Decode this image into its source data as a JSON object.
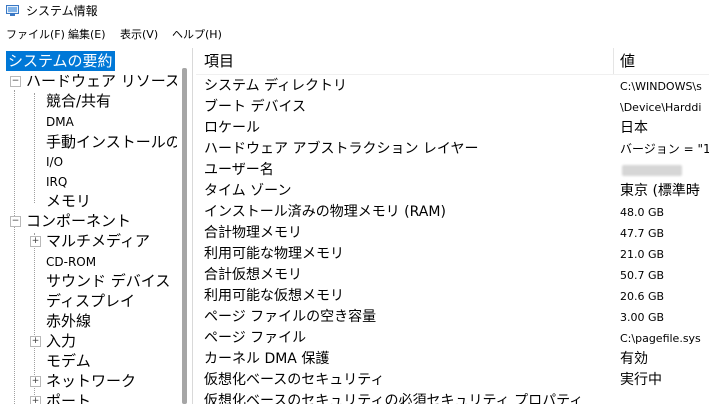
{
  "window": {
    "title": "システム情報",
    "icon": "system-info-icon"
  },
  "menu": [
    {
      "label": "ファイル(F)"
    },
    {
      "label": "編集(E)"
    },
    {
      "label": "表示(V)"
    },
    {
      "label": "ヘルプ(H)"
    }
  ],
  "tree": {
    "root": "システムの要約",
    "hardware": "ハードウェア リソース",
    "hardware_items": [
      "競合/共有",
      "DMA",
      "手動インストールのハ",
      "I/O",
      "IRQ",
      "メモリ"
    ],
    "components": "コンポーネント",
    "component_items": [
      "マルチメディア",
      "CD-ROM",
      "サウンド デバイス",
      "ディスプレイ",
      "赤外線",
      "入力",
      "モデム",
      "ネットワーク",
      "ポート"
    ]
  },
  "list": {
    "headers": {
      "item": "項目",
      "value": "値"
    },
    "rows": [
      {
        "item": "システム ディレクトリ",
        "value": "C:\\WINDOWS\\s"
      },
      {
        "item": "ブート デバイス",
        "value": "\\Device\\Harddi"
      },
      {
        "item": "ロケール",
        "value": "日本"
      },
      {
        "item": "ハードウェア アブストラクション レイヤー",
        "value": "バージョン = \"1"
      },
      {
        "item": "ユーザー名",
        "value": ""
      },
      {
        "item": "タイム ゾーン",
        "value": "東京 (標準時"
      },
      {
        "item": "インストール済みの物理メモリ (RAM)",
        "value": "48.0 GB"
      },
      {
        "item": "合計物理メモリ",
        "value": "47.7 GB"
      },
      {
        "item": "利用可能な物理メモリ",
        "value": "21.0 GB"
      },
      {
        "item": "合計仮想メモリ",
        "value": "50.7 GB"
      },
      {
        "item": "利用可能な仮想メモリ",
        "value": "20.6 GB"
      },
      {
        "item": "ページ ファイルの空き容量",
        "value": "3.00 GB"
      },
      {
        "item": "ページ ファイル",
        "value": "C:\\pagefile.sys"
      },
      {
        "item": "カーネル DMA 保護",
        "value": "有効"
      },
      {
        "item": "仮想化ベースのセキュリティ",
        "value": "実行中"
      },
      {
        "item": "仮想化ベースのセキュリティの必須セキュリティ プロパティ",
        "value": ""
      }
    ]
  },
  "colors": {
    "selection": "#0078d7",
    "scroll_thumb": "#a6a6a6"
  }
}
